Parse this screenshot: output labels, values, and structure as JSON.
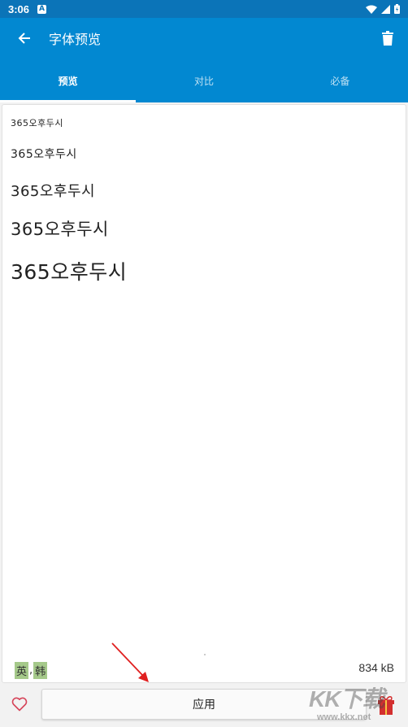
{
  "status_bar": {
    "time": "3:06",
    "notification_glyph": "A"
  },
  "app_bar": {
    "title": "字体预览"
  },
  "tabs": [
    {
      "label": "预览",
      "active": true
    },
    {
      "label": "对比",
      "active": false
    },
    {
      "label": "必备",
      "active": false
    }
  ],
  "preview": {
    "samples": [
      "365오후두시",
      "365오후두시",
      "365오후두시",
      "365오후두시",
      "365오후두시"
    ]
  },
  "footer": {
    "lang_tags": [
      "英",
      "韩"
    ],
    "tag_separator": ",",
    "file_size": "834 kB"
  },
  "bottom_bar": {
    "apply_label": "应用"
  },
  "watermark": {
    "logo_text": "KK下载",
    "url_text": "www.kkx.net"
  },
  "colors": {
    "primary": "#0288d1",
    "status_bar": "#0b74b8",
    "tag_bg": "#a5c98a",
    "arrow": "#e02020",
    "gift": "#d32f2f"
  },
  "icons": [
    "back-arrow-icon",
    "trash-icon",
    "heart-icon",
    "gift-icon",
    "wifi-icon",
    "signal-icon",
    "battery-icon"
  ]
}
